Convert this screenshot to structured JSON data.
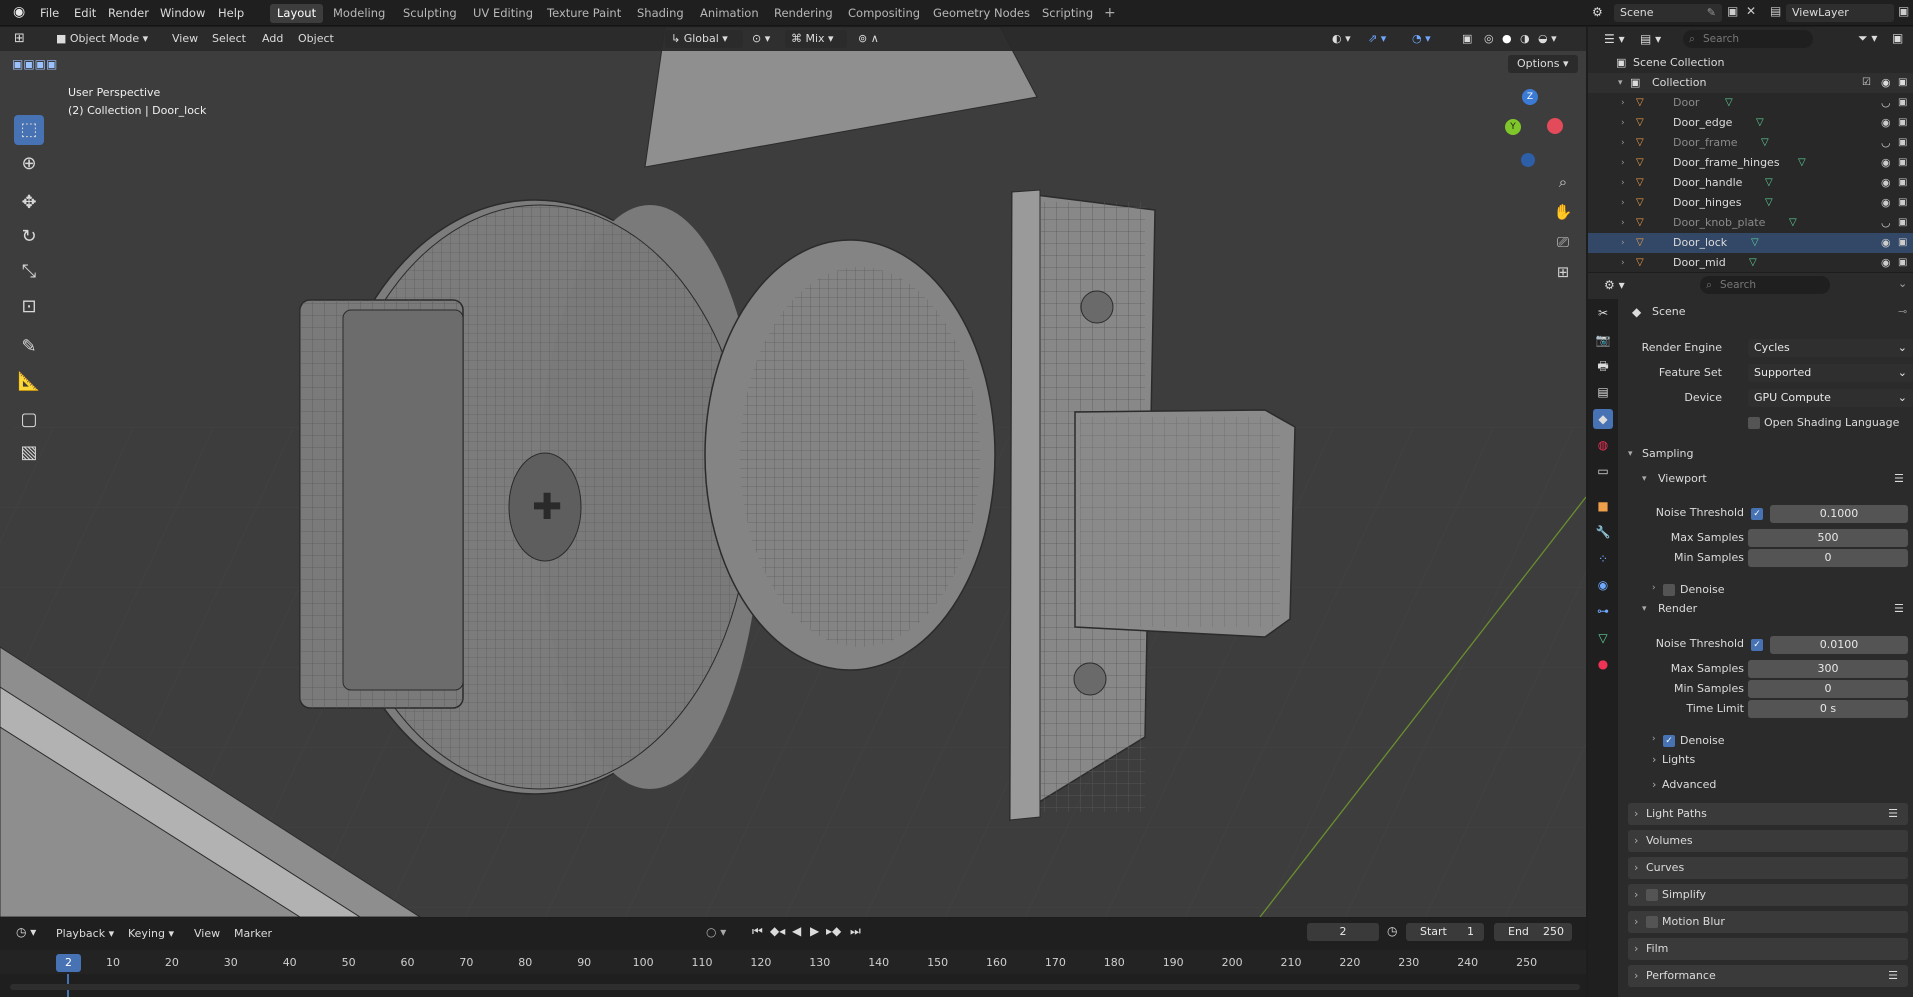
{
  "app": {
    "menus": [
      "File",
      "Edit",
      "Render",
      "Window",
      "Help"
    ],
    "workspaces": [
      "Layout",
      "Modeling",
      "Sculpting",
      "UV Editing",
      "Texture Paint",
      "Shading",
      "Animation",
      "Rendering",
      "Compositing",
      "Geometry Nodes",
      "Scripting"
    ],
    "active_workspace": "Layout",
    "scene_name": "Scene",
    "view_layer": "ViewLayer"
  },
  "viewport": {
    "mode": "Object Mode",
    "menus": [
      "View",
      "Select",
      "Add",
      "Object"
    ],
    "transform_orientation": "Global",
    "snap_mode": "Mix",
    "options_label": "Options",
    "info_line1": "User Perspective",
    "info_line2": "(2) Collection | Door_lock",
    "gizmo_axes": {
      "z": "Z",
      "y": "Y"
    }
  },
  "outliner": {
    "search_placeholder": "Search",
    "scene_collection": "Scene Collection",
    "collection": "Collection",
    "items": [
      {
        "name": "Door",
        "dim": true
      },
      {
        "name": "Door_edge",
        "dim": false
      },
      {
        "name": "Door_frame",
        "dim": true
      },
      {
        "name": "Door_frame_hinges",
        "dim": false
      },
      {
        "name": "Door_handle",
        "dim": false
      },
      {
        "name": "Door_hinges",
        "dim": false
      },
      {
        "name": "Door_knob_plate",
        "dim": true
      },
      {
        "name": "Door_lock",
        "dim": false
      },
      {
        "name": "Door_mid",
        "dim": false
      }
    ]
  },
  "properties": {
    "search_placeholder": "Search",
    "context": "Scene",
    "render_engine_label": "Render Engine",
    "render_engine": "Cycles",
    "feature_set_label": "Feature Set",
    "feature_set": "Supported",
    "device_label": "Device",
    "device": "GPU Compute",
    "osl_label": "Open Shading Language",
    "sampling": "Sampling",
    "viewport": "Viewport",
    "vp_noise_threshold_label": "Noise Threshold",
    "vp_noise_threshold": "0.1000",
    "vp_max_samples_label": "Max Samples",
    "vp_max_samples": "500",
    "vp_min_samples_label": "Min Samples",
    "vp_min_samples": "0",
    "vp_denoise": "Denoise",
    "render": "Render",
    "r_noise_threshold_label": "Noise Threshold",
    "r_noise_threshold": "0.0100",
    "r_max_samples_label": "Max Samples",
    "r_max_samples": "300",
    "r_min_samples_label": "Min Samples",
    "r_min_samples": "0",
    "r_time_limit_label": "Time Limit",
    "r_time_limit": "0 s",
    "r_denoise": "Denoise",
    "lights": "Lights",
    "advanced": "Advanced",
    "panels": [
      "Light Paths",
      "Volumes",
      "Curves",
      "Simplify",
      "Motion Blur",
      "Film",
      "Performance"
    ]
  },
  "timeline": {
    "menus": [
      "Playback",
      "Keying",
      "View",
      "Marker"
    ],
    "current_frame": "2",
    "start_label": "Start",
    "start": "1",
    "end_label": "End",
    "end": "250",
    "ruler": [
      "10",
      "20",
      "30",
      "40",
      "50",
      "60",
      "70",
      "80",
      "90",
      "100",
      "110",
      "120",
      "130",
      "140",
      "150",
      "160",
      "170",
      "180",
      "190",
      "200",
      "210",
      "220",
      "230",
      "240",
      "250"
    ],
    "playhead": "2"
  },
  "colors": {
    "accent": "#4772b3",
    "object_orange": "#f0a04b",
    "mesh_green": "#5fd39a",
    "viewport_bg": "#3d3d3d"
  }
}
